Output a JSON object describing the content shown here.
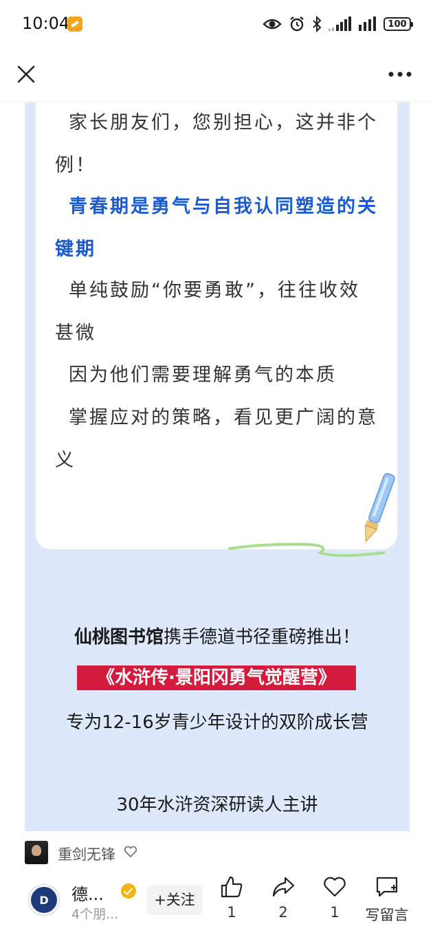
{
  "status_bar": {
    "time": "10:04",
    "battery": "100"
  },
  "article": {
    "paragraphs": [
      {
        "text": "家长朋友们，您别担心，这并非个例！",
        "highlight": false
      },
      {
        "text": "青春期是勇气与自我认同塑造的关键期",
        "highlight": true
      },
      {
        "text": "单纯鼓励“你要勇敢”，往往收效甚微",
        "highlight": false
      },
      {
        "text": "因为他们需要理解勇气的本质",
        "highlight": false
      },
      {
        "text": "掌握应对的策略，看见更广阔的意义",
        "highlight": false
      }
    ],
    "promo": {
      "library_name": "仙桃图书馆",
      "line1_rest": "携手德道书径重磅推出！",
      "banner": "《水浒传·景阳冈勇气觉醒营》",
      "line3": "专为12-16岁青少年设计的双阶成长营",
      "line4": "30年水浒资深研读人主讲"
    }
  },
  "bottom": {
    "liker_name": "重剑无锋",
    "account_name": "德...",
    "account_friends": "4个朋...",
    "follow_label": "+关注",
    "like_count": "1",
    "share_count": "2",
    "favorite_count": "1",
    "comment_label": "写留言"
  },
  "colors": {
    "highlight_blue": "#1a5ccf",
    "banner_red": "#d31c3d",
    "content_bg": "#dde8fa",
    "verified_gold": "#f2b416"
  },
  "icons": [
    "eye-icon",
    "alarm-icon",
    "bluetooth-icon",
    "signal-icon",
    "battery-icon",
    "close-icon",
    "more-icon",
    "heart-icon",
    "thumbs-up-icon",
    "share-icon",
    "comment-icon",
    "verified-icon"
  ]
}
